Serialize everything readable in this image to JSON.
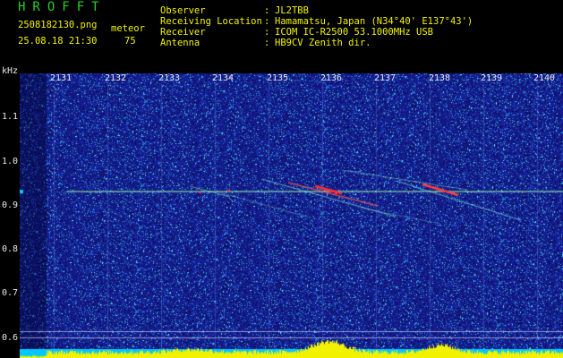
{
  "header": {
    "brand": "HROFFT",
    "filename": "2508182130.png",
    "datetime": "25.08.18 21:30",
    "mode_label": "meteor",
    "count": "75",
    "fields": [
      {
        "label": "Observer",
        "sep": ":",
        "value": "JL2TBB"
      },
      {
        "label": "Receiving Location",
        "sep": ":",
        "value": "Hamamatsu, Japan (N34°40' E137°43')"
      },
      {
        "label": "Receiver",
        "sep": ":",
        "value": "ICOM IC-R2500 53.1000MHz USB"
      },
      {
        "label": "Antenna",
        "sep": ":",
        "value": "HB9CV Zenith dir."
      }
    ]
  },
  "axes": {
    "y_unit": "kHz",
    "x_ticks": [
      "2131",
      "2132",
      "2133",
      "2134",
      "2135",
      "2136",
      "2137",
      "2138",
      "2139",
      "2140"
    ],
    "y_ticks": [
      "1.1",
      "1.0",
      "0.9",
      "0.8",
      "0.7",
      "0.6"
    ]
  },
  "colors": {
    "background": "#000000",
    "spectrum_base": "#1a1a8c",
    "carrier": "#9cffb0",
    "echo_hot": "#ff3030",
    "band_fill": "#00c8ff",
    "signal_yellow": "#f2f200"
  }
}
